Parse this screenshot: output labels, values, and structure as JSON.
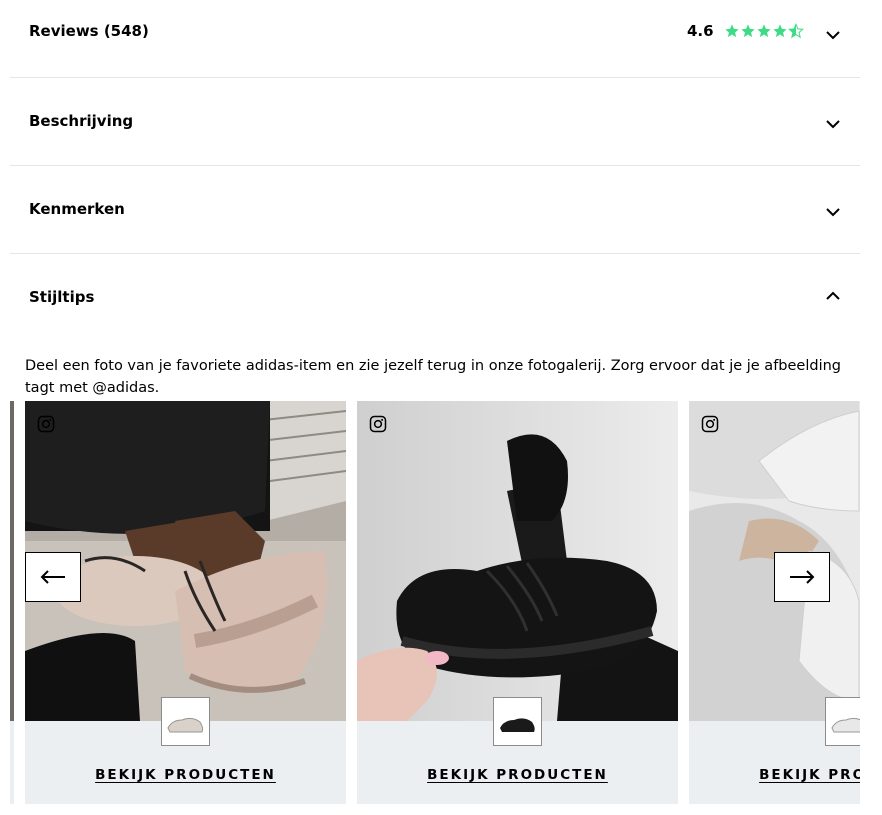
{
  "accordion": [
    {
      "title": "Reviews (548)",
      "expanded": false,
      "rating": "4.6",
      "stars": 4.6,
      "star_color": "#3ddc84"
    },
    {
      "title": "Beschrijving",
      "expanded": false
    },
    {
      "title": "Kenmerken",
      "expanded": false
    },
    {
      "title": "Stijltips",
      "expanded": true
    }
  ],
  "stijltips": {
    "description": "Deel een foto van je favoriete adidas-item en zie jezelf terug in onze fotogalerij. Zorg ervoor dat je je afbeelding tagt met @adidas.",
    "cards": [
      {
        "cta": "BEKIJK PRODUCTEN",
        "photo": "beige-sneakers-on-feet",
        "product": "beige-sneaker"
      },
      {
        "cta": "BEKIJK PRODUCTEN",
        "photo": "black-sneaker-held",
        "product": "black-sneaker"
      },
      {
        "cta": "BEKIJK PRODUCTEN",
        "photo": "white-sneakers-on-bed",
        "product": "white-sneaker"
      }
    ],
    "prev_icon": "arrow-left-icon",
    "next_icon": "arrow-right-icon"
  },
  "colors": {
    "card_bg": "#eceff1",
    "star": "#3ddc84",
    "divider": "#e5e5e5"
  }
}
